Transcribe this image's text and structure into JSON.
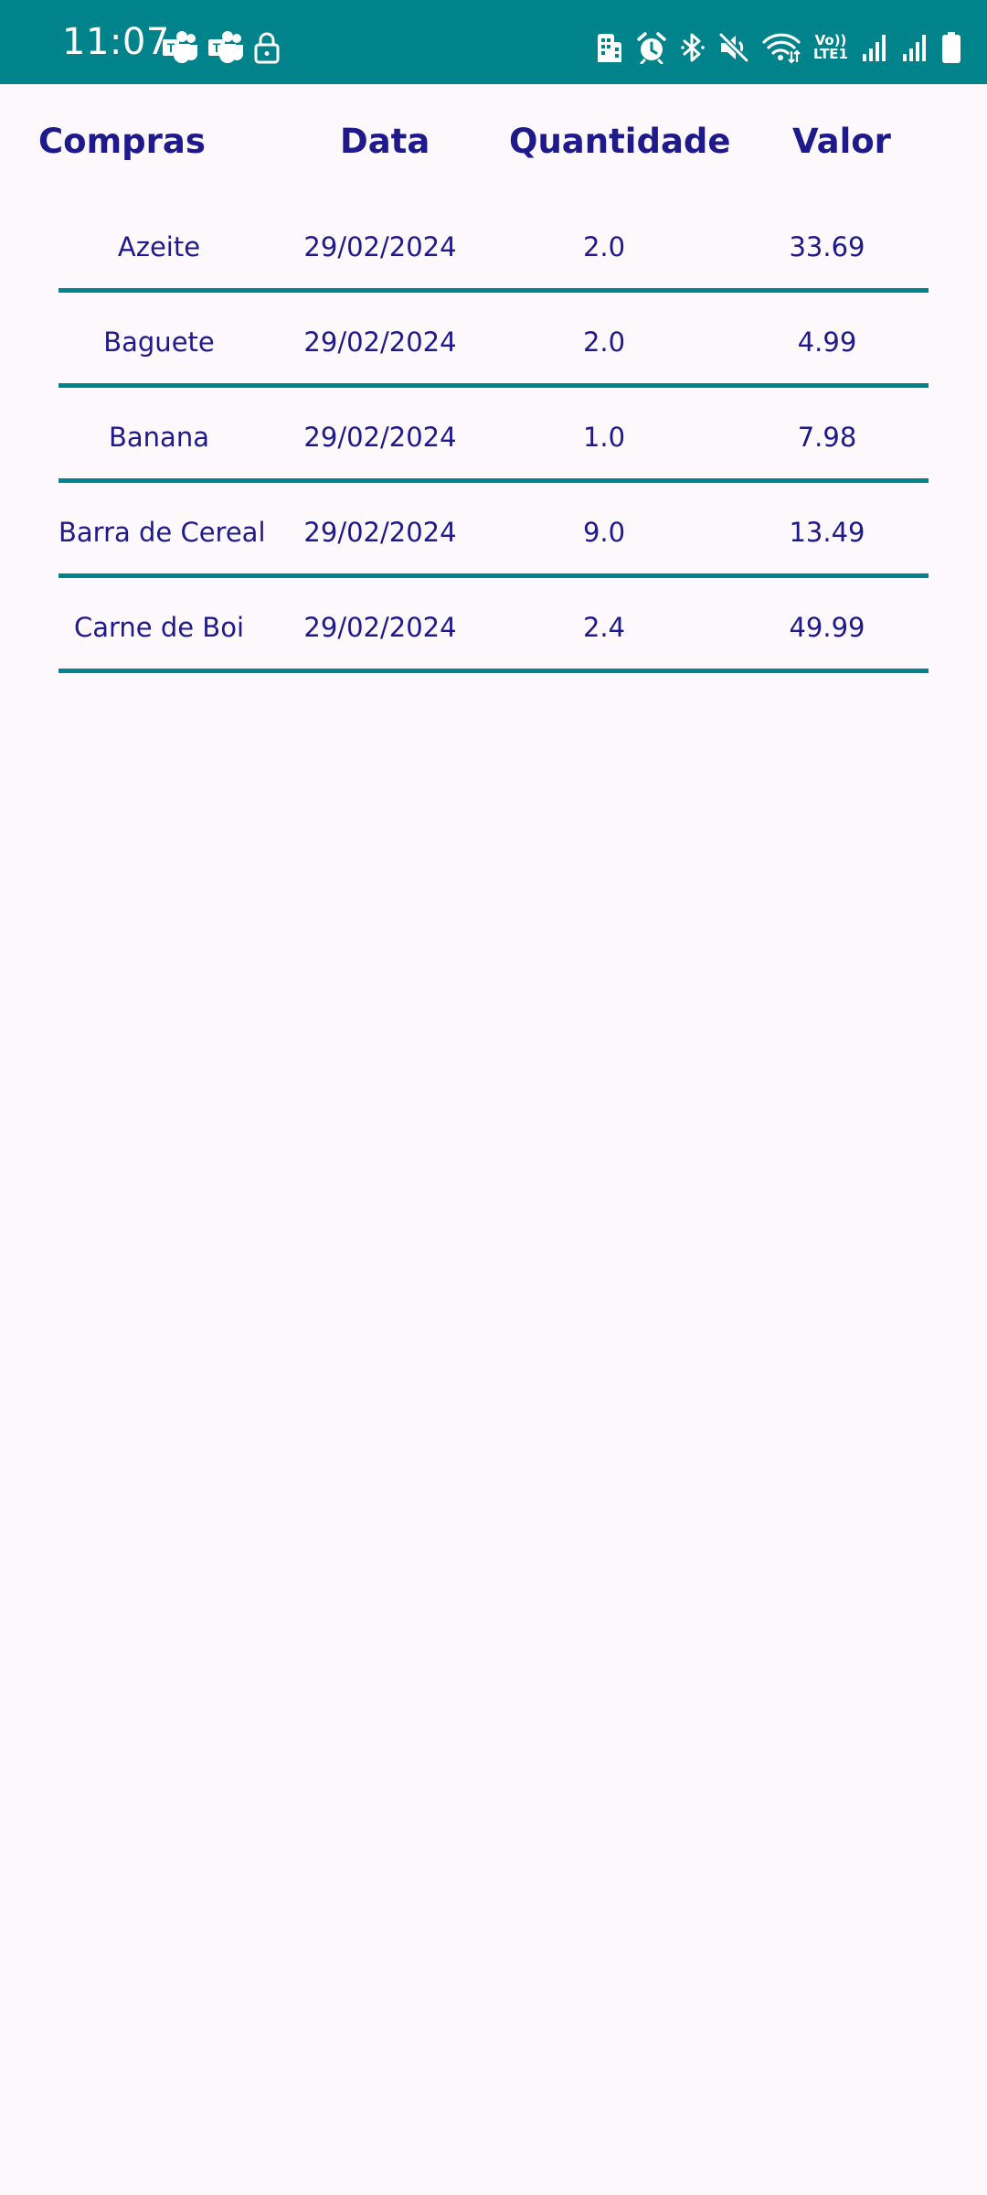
{
  "status_bar": {
    "time": "11:07",
    "left_icons": [
      "teams-icon",
      "teams-icon",
      "lock-icon"
    ],
    "right_icons": [
      "building-icon",
      "alarm-icon",
      "bluetooth-icon",
      "mute-icon",
      "wifi-icon",
      "lte-icon",
      "signal-icon",
      "signal-icon",
      "battery-icon"
    ],
    "lte_top": "Vo))",
    "lte_bottom": "LTE1",
    "background": "#00838B"
  },
  "table": {
    "headers": {
      "compras": "Compras",
      "data": "Data",
      "quantidade": "Quantidade",
      "valor": "Valor"
    },
    "rows": [
      {
        "compra": "Azeite",
        "data": "29/02/2024",
        "quantidade": "2.0",
        "valor": "33.69"
      },
      {
        "compra": "Baguete",
        "data": "29/02/2024",
        "quantidade": "2.0",
        "valor": "4.99"
      },
      {
        "compra": "Banana",
        "data": "29/02/2024",
        "quantidade": "1.0",
        "valor": "7.98"
      },
      {
        "compra": "Barra de Cereal",
        "data": "29/02/2024",
        "quantidade": "9.0",
        "valor": "13.49"
      },
      {
        "compra": "Carne de Boi",
        "data": "29/02/2024",
        "quantidade": "2.4",
        "valor": "49.99"
      }
    ]
  },
  "colors": {
    "accent": "#00838B",
    "text": "#1F1A8C",
    "background": "#FDF8FC"
  }
}
